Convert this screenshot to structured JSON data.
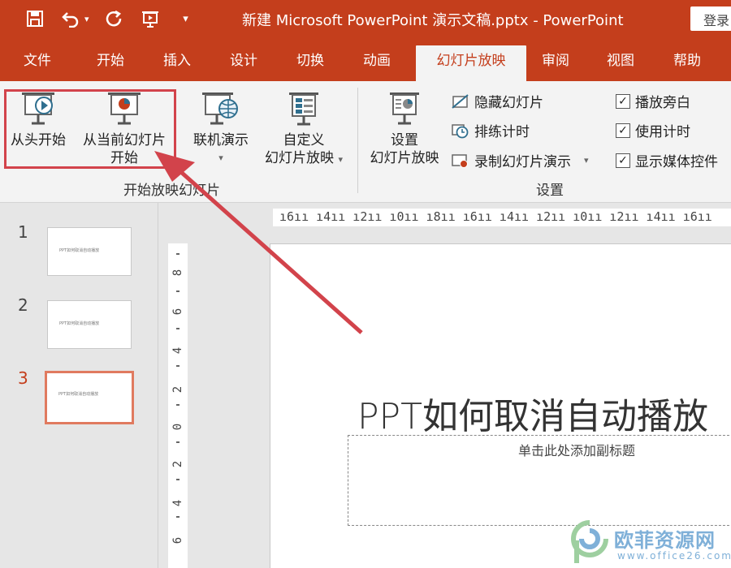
{
  "titlebar": {
    "title": "新建 Microsoft PowerPoint 演示文稿.pptx  -  PowerPoint",
    "login_label": "登录",
    "qat_dropdown_glyph": "▾",
    "qat_customize_glyph": "▾",
    "color": "#c43e1c"
  },
  "tabs": [
    "文件",
    "开始",
    "插入",
    "设计",
    "切换",
    "动画",
    "幻灯片放映",
    "审阅",
    "视图",
    "帮助"
  ],
  "ribbon": {
    "start_group": {
      "from_beginning": "从头开始",
      "from_current_line1": "从当前幻灯片",
      "from_current_line2": "开始",
      "online_present": "联机演示",
      "online_present_arrow": "▾",
      "custom_line1": "自定义",
      "custom_line2": "幻灯片放映",
      "custom_arrow": "▾",
      "label": "开始放映幻灯片"
    },
    "setup_group": {
      "setup_line1": "设置",
      "setup_line2": "幻灯片放映",
      "hide_slide": "隐藏幻灯片",
      "rehearse": "排练计时",
      "record": "录制幻灯片演示",
      "record_arrow": "▾",
      "play_narrations": "播放旁白",
      "use_timings": "使用计时",
      "show_media_controls": "显示媒体控件",
      "label": "设置",
      "checkbox_mark": "✓"
    }
  },
  "slides": {
    "numbers": [
      "1",
      "2",
      "3"
    ],
    "thumb_text": "PPT如何取消自动播放",
    "active_index": 3
  },
  "ruler": {
    "horizontal": "ı6ıı ı4ıı ı2ıı ı0ıı ı8ıı ı6ıı ı4ıı ı2ıı ı0ıı ı2ıı ı4ıı ı6ıı",
    "vertical": [
      "8",
      "6",
      "4",
      "2",
      "0",
      "2",
      "4",
      "6"
    ]
  },
  "slide": {
    "title": "PPT如何取消自动播放",
    "subtitle_placeholder": "单击此处添加副标题"
  },
  "watermark": {
    "name": "欧菲资源网",
    "url": "www.office26.com"
  }
}
